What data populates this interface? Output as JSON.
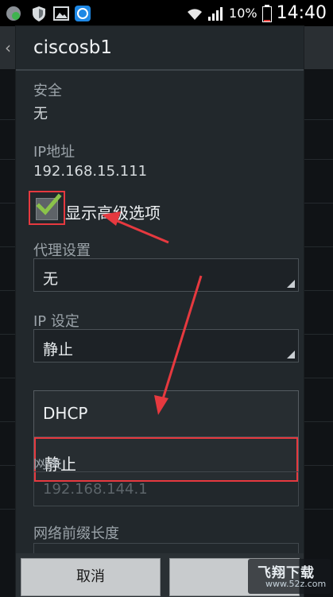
{
  "status_bar": {
    "battery": "10%",
    "time": "14:40"
  },
  "dialog": {
    "title": "ciscosb1",
    "security": {
      "label": "安全",
      "value": "无"
    },
    "ip_address": {
      "label": "IP地址",
      "value": "192.168.15.111"
    },
    "advanced": {
      "label": "显示高级选项",
      "checked": true
    },
    "proxy": {
      "label": "代理设置",
      "value": "无"
    },
    "ip_settings": {
      "label": "IP 设定",
      "value": "静止",
      "options": [
        "DHCP",
        "静止"
      ],
      "highlighted_option": "静止"
    },
    "gateway": {
      "label": "网关",
      "placeholder": "192.168.144.1"
    },
    "prefix": {
      "label": "网络前缀长度"
    },
    "buttons": {
      "cancel": "取消"
    }
  },
  "watermark": {
    "line1": "飞翔下载",
    "line2": "www.52z.com"
  },
  "colors": {
    "highlight": "#e6393f",
    "checkmark": "#8bc34a",
    "dialog_bg": "#22282c"
  }
}
